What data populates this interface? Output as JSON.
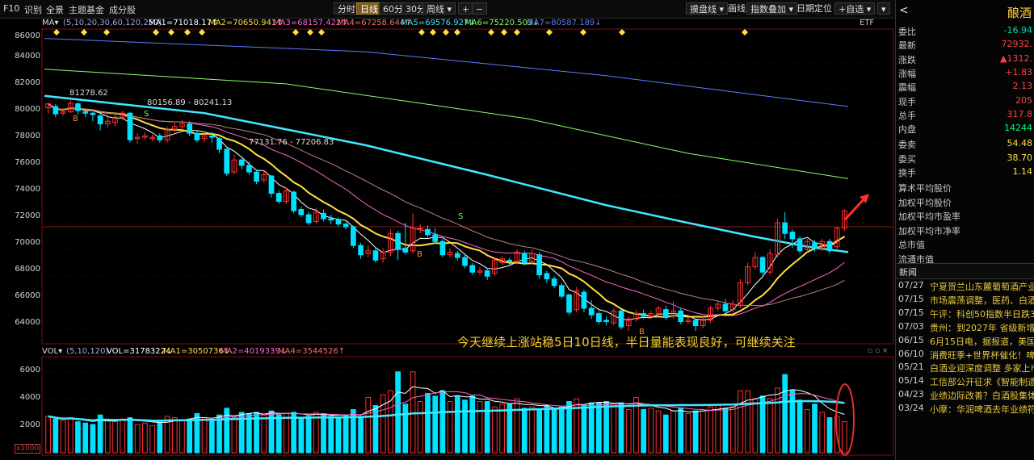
{
  "topbar": {
    "items": [
      "F10",
      "识别",
      "全景",
      "主题基金",
      "成分股"
    ],
    "periods": [
      "分时",
      "日线",
      "60分",
      "30分",
      "周线 ▾"
    ],
    "active_period": "日线",
    "zoom": [
      "+",
      "−"
    ],
    "right_items": [
      "摸盘线 ▾",
      "画线",
      "指数叠加 ▾",
      "日期定位",
      "+自选 ▾",
      "▾"
    ]
  },
  "ma_line": {
    "label": "MA▾",
    "params": "(5,10,20,30,60,120,250)",
    "ma1": "MA1=71018.17↑",
    "ma2": "MA2=70650.941↑",
    "ma3": "MA3=68157.422↑",
    "ma4": "MA4=67258.644↑",
    "ma5": "MA5=69576.927↓",
    "ma6": "MA6=75220.503↓",
    "ma7": "MA7=80587.189↓",
    "etf": "ETF"
  },
  "price_axis": [
    "86000",
    "84000",
    "82000",
    "80000",
    "78000",
    "76000",
    "74000",
    "72000",
    "70000",
    "68000",
    "66000",
    "64000"
  ],
  "annotations": {
    "high_label": "81278.62",
    "range1": "80156.89 - 80241.13",
    "range2": "77131.76 - 77206.83",
    "comment": "今天继续上涨站稳5日10日线，半日量能表现良好，可继续关注",
    "b": "B",
    "s": "S"
  },
  "vol_line": {
    "label": "VOL▾",
    "params": "(5,10,120)",
    "vol": "VOL=3178322↓",
    "ma1": "MA1=3050736↓",
    "ma2": "MA2=4019339↓",
    "ma4": "MA4=3544526↑"
  },
  "vol_axis": [
    "6000",
    "4000",
    "2000"
  ],
  "vol_unit": "x1000",
  "bottom_fragment": "...",
  "right_panel": {
    "title": "酿酒",
    "back": "<",
    "quotes": [
      {
        "k": "委比",
        "v": "-16.94"
      },
      {
        "k": "最新",
        "v": "72932."
      },
      {
        "k": "涨跌",
        "v": "▲1312."
      },
      {
        "k": "涨幅",
        "v": "+1.83"
      },
      {
        "k": "震幅",
        "v": "2.13"
      },
      {
        "k": "现手",
        "v": "205"
      },
      {
        "k": "总手",
        "v": "317.8"
      },
      {
        "k": "内盘",
        "v": "14244"
      },
      {
        "k": "委卖",
        "v": "54.48"
      },
      {
        "k": "委买",
        "v": "38.70"
      },
      {
        "k": "换手",
        "v": "1.14"
      }
    ],
    "stats": [
      "算术平均股价",
      "加权平均股价",
      "加权平均市盈率",
      "加权平均市净率",
      "总市值",
      "流通市值"
    ],
    "news_title": "新闻",
    "news": [
      {
        "d": "07/27",
        "t": "宁夏贺兰山东麓葡萄酒产业"
      },
      {
        "d": "07/15",
        "t": "市场震荡调整，医药、白酒"
      },
      {
        "d": "07/15",
        "t": "午评：科创50指数半日跌3"
      },
      {
        "d": "07/03",
        "t": "贵州：到2027年 省级新增"
      },
      {
        "d": "06/15",
        "t": "6月15日电，据报道，美国"
      },
      {
        "d": "06/10",
        "t": "消费旺季+世界杯催化！啤"
      },
      {
        "d": "05/21",
        "t": "白酒业迎深度调整 多家上市"
      },
      {
        "d": "05/14",
        "t": "工信部公开征求《智能制造"
      },
      {
        "d": "04/23",
        "t": "业绩边际改善？白酒股集体"
      },
      {
        "d": "03/24",
        "t": "小摩：华润啤酒去年业绩符"
      }
    ]
  },
  "colors": {
    "up": "#ff3030",
    "down": "#00e0ff",
    "yellow": "#ffe040",
    "bg": "#000000"
  },
  "chart_data": {
    "type": "candlestick",
    "price_axis_range": [
      63000,
      86500
    ],
    "candles": [
      [
        80600,
        80900,
        80200,
        81000
      ],
      [
        80700,
        80150,
        79900,
        80900
      ],
      [
        80200,
        80300,
        80000,
        80600
      ],
      [
        80300,
        80950,
        80200,
        81280
      ],
      [
        80900,
        80400,
        80100,
        81000
      ],
      [
        80300,
        80200,
        79900,
        80400
      ],
      [
        80200,
        80100,
        79600,
        80300
      ],
      [
        80000,
        79400,
        78900,
        80200
      ],
      [
        79400,
        79600,
        79100,
        80100
      ],
      [
        79500,
        79900,
        79200,
        80200
      ],
      [
        79900,
        80200,
        79700,
        80400
      ],
      [
        80200,
        78200,
        78000,
        80300
      ],
      [
        78300,
        78400,
        77900,
        78700
      ],
      [
        78400,
        78500,
        78200,
        78800
      ],
      [
        78300,
        78400,
        78100,
        78600
      ],
      [
        78500,
        78200,
        78000,
        78700
      ],
      [
        78200,
        79000,
        78000,
        79200
      ],
      [
        79000,
        79200,
        78600,
        79500
      ],
      [
        79200,
        79400,
        78900,
        79700
      ],
      [
        79400,
        78700,
        78500,
        79600
      ],
      [
        78700,
        78200,
        78000,
        78900
      ],
      [
        78300,
        78500,
        78000,
        78700
      ],
      [
        78500,
        78400,
        78000,
        78800
      ],
      [
        78300,
        77500,
        77200,
        78400
      ],
      [
        77500,
        75700,
        75500,
        77600
      ],
      [
        75800,
        76700,
        75600,
        77100
      ],
      [
        76700,
        76300,
        76000,
        77000
      ],
      [
        76300,
        75800,
        75600,
        76600
      ],
      [
        75800,
        75100,
        74900,
        76000
      ],
      [
        75200,
        75600,
        75000,
        75900
      ],
      [
        75500,
        74200,
        73900,
        75600
      ],
      [
        74200,
        73600,
        73400,
        74400
      ],
      [
        73600,
        74400,
        73400,
        74600
      ],
      [
        74300,
        72900,
        72700,
        74400
      ],
      [
        73000,
        72600,
        72400,
        73200
      ],
      [
        72600,
        72000,
        71800,
        72800
      ],
      [
        72100,
        72800,
        71900,
        73100
      ],
      [
        72700,
        72300,
        72100,
        73000
      ],
      [
        72300,
        72200,
        71900,
        72600
      ],
      [
        72200,
        71900,
        71700,
        72400
      ],
      [
        71900,
        71700,
        71500,
        72100
      ],
      [
        71700,
        70300,
        70100,
        71800
      ],
      [
        70300,
        69600,
        69300,
        70500
      ],
      [
        69700,
        69900,
        69400,
        70300
      ],
      [
        69900,
        69200,
        69000,
        70100
      ],
      [
        69300,
        69800,
        69000,
        70100
      ],
      [
        69800,
        71200,
        69500,
        71500
      ],
      [
        71200,
        70000,
        69200,
        71400
      ],
      [
        70100,
        69800,
        69600,
        72000
      ],
      [
        69900,
        71600,
        69700,
        72700
      ],
      [
        71600,
        71600,
        71200,
        71900
      ],
      [
        71500,
        71100,
        70900,
        71800
      ],
      [
        71100,
        70600,
        70400,
        71600
      ],
      [
        70600,
        69600,
        69400,
        70800
      ],
      [
        69600,
        69800,
        69400,
        70100
      ],
      [
        69700,
        69400,
        69200,
        69900
      ],
      [
        69400,
        68800,
        68600,
        69600
      ],
      [
        68800,
        68300,
        68100,
        69000
      ],
      [
        68300,
        68400,
        68100,
        68700
      ],
      [
        68400,
        68000,
        67700,
        68600
      ],
      [
        68200,
        69200,
        68000,
        69400
      ],
      [
        69000,
        69300,
        68800,
        69500
      ],
      [
        69200,
        69100,
        68800,
        69400
      ],
      [
        69100,
        69800,
        68900,
        70000
      ],
      [
        69700,
        69000,
        68800,
        69900
      ],
      [
        69100,
        69700,
        68900,
        70000
      ],
      [
        69600,
        68100,
        67800,
        69800
      ],
      [
        68200,
        67800,
        67500,
        68400
      ],
      [
        67800,
        67300,
        67100,
        68000
      ],
      [
        67300,
        66500,
        66300,
        67500
      ],
      [
        66600,
        65300,
        65100,
        66700
      ],
      [
        65500,
        66900,
        65300,
        67200
      ],
      [
        66800,
        65600,
        65300,
        67000
      ],
      [
        65600,
        65100,
        64800,
        66200
      ],
      [
        65200,
        64600,
        64400,
        65400
      ],
      [
        64700,
        64600,
        64300,
        65000
      ],
      [
        64500,
        65400,
        64300,
        65600
      ],
      [
        65400,
        64200,
        64000,
        65500
      ],
      [
        64300,
        64800,
        63900,
        65000
      ],
      [
        64800,
        65200,
        64600,
        65500
      ],
      [
        65200,
        65000,
        64800,
        65500
      ],
      [
        65000,
        65200,
        64800,
        65400
      ],
      [
        65200,
        65600,
        65000,
        65800
      ],
      [
        65500,
        64900,
        64700,
        65800
      ],
      [
        65000,
        65400,
        64800,
        66100
      ],
      [
        65400,
        64600,
        64400,
        65600
      ],
      [
        64600,
        64700,
        64400,
        65000
      ],
      [
        64700,
        64300,
        63900,
        64800
      ],
      [
        64300,
        64700,
        64100,
        65000
      ],
      [
        64700,
        65600,
        64500,
        65800
      ],
      [
        65600,
        65900,
        65400,
        66100
      ],
      [
        65900,
        65400,
        65200,
        66300
      ],
      [
        65500,
        65900,
        65300,
        66200
      ],
      [
        65800,
        67500,
        65600,
        67800
      ],
      [
        67500,
        68700,
        67300,
        69000
      ],
      [
        68700,
        69400,
        68500,
        69800
      ],
      [
        69400,
        68300,
        68100,
        69500
      ],
      [
        68300,
        69700,
        68100,
        70000
      ],
      [
        69600,
        72000,
        69400,
        72300
      ],
      [
        72000,
        71200,
        70800,
        72800
      ],
      [
        71300,
        70800,
        70100,
        71500
      ],
      [
        70800,
        69900,
        69700,
        71000
      ],
      [
        70000,
        70600,
        69800,
        70800
      ],
      [
        70500,
        70100,
        69800,
        70700
      ],
      [
        70100,
        70600,
        69900,
        70800
      ],
      [
        70600,
        69900,
        69700,
        70800
      ],
      [
        70200,
        71600,
        70000,
        71700
      ],
      [
        71600,
        72900,
        71400,
        73000
      ]
    ],
    "volumes": [
      2700,
      2500,
      2400,
      2600,
      2300,
      2200,
      2100,
      2800,
      2400,
      2300,
      2500,
      2600,
      2100,
      2200,
      2000,
      2300,
      2700,
      2600,
      2400,
      2500,
      2900,
      2600,
      2400,
      2800,
      3300,
      2600,
      3000,
      2900,
      3000,
      2800,
      3100,
      2800,
      2900,
      3000,
      2600,
      2700,
      3000,
      2900,
      2700,
      2600,
      2800,
      3200,
      2700,
      4100,
      3500,
      4300,
      4600,
      6000,
      3600,
      6000,
      3800,
      4400,
      4200,
      4600,
      3800,
      4200,
      3900,
      4200,
      3800,
      3800,
      3400,
      3600,
      3600,
      4000,
      3300,
      3400,
      3200,
      3500,
      3200,
      3400,
      3800,
      4000,
      3500,
      3700,
      3700,
      3800,
      3600,
      3700,
      3200,
      4100,
      3200,
      3300,
      3100,
      2800,
      3100,
      3300,
      2900,
      3100,
      3100,
      3400,
      3600,
      3300,
      3400,
      4600,
      4600,
      4000,
      4200,
      4000,
      4800,
      5800,
      4600,
      3900,
      3200,
      3600,
      3000,
      2600,
      2700,
      2300
    ]
  }
}
